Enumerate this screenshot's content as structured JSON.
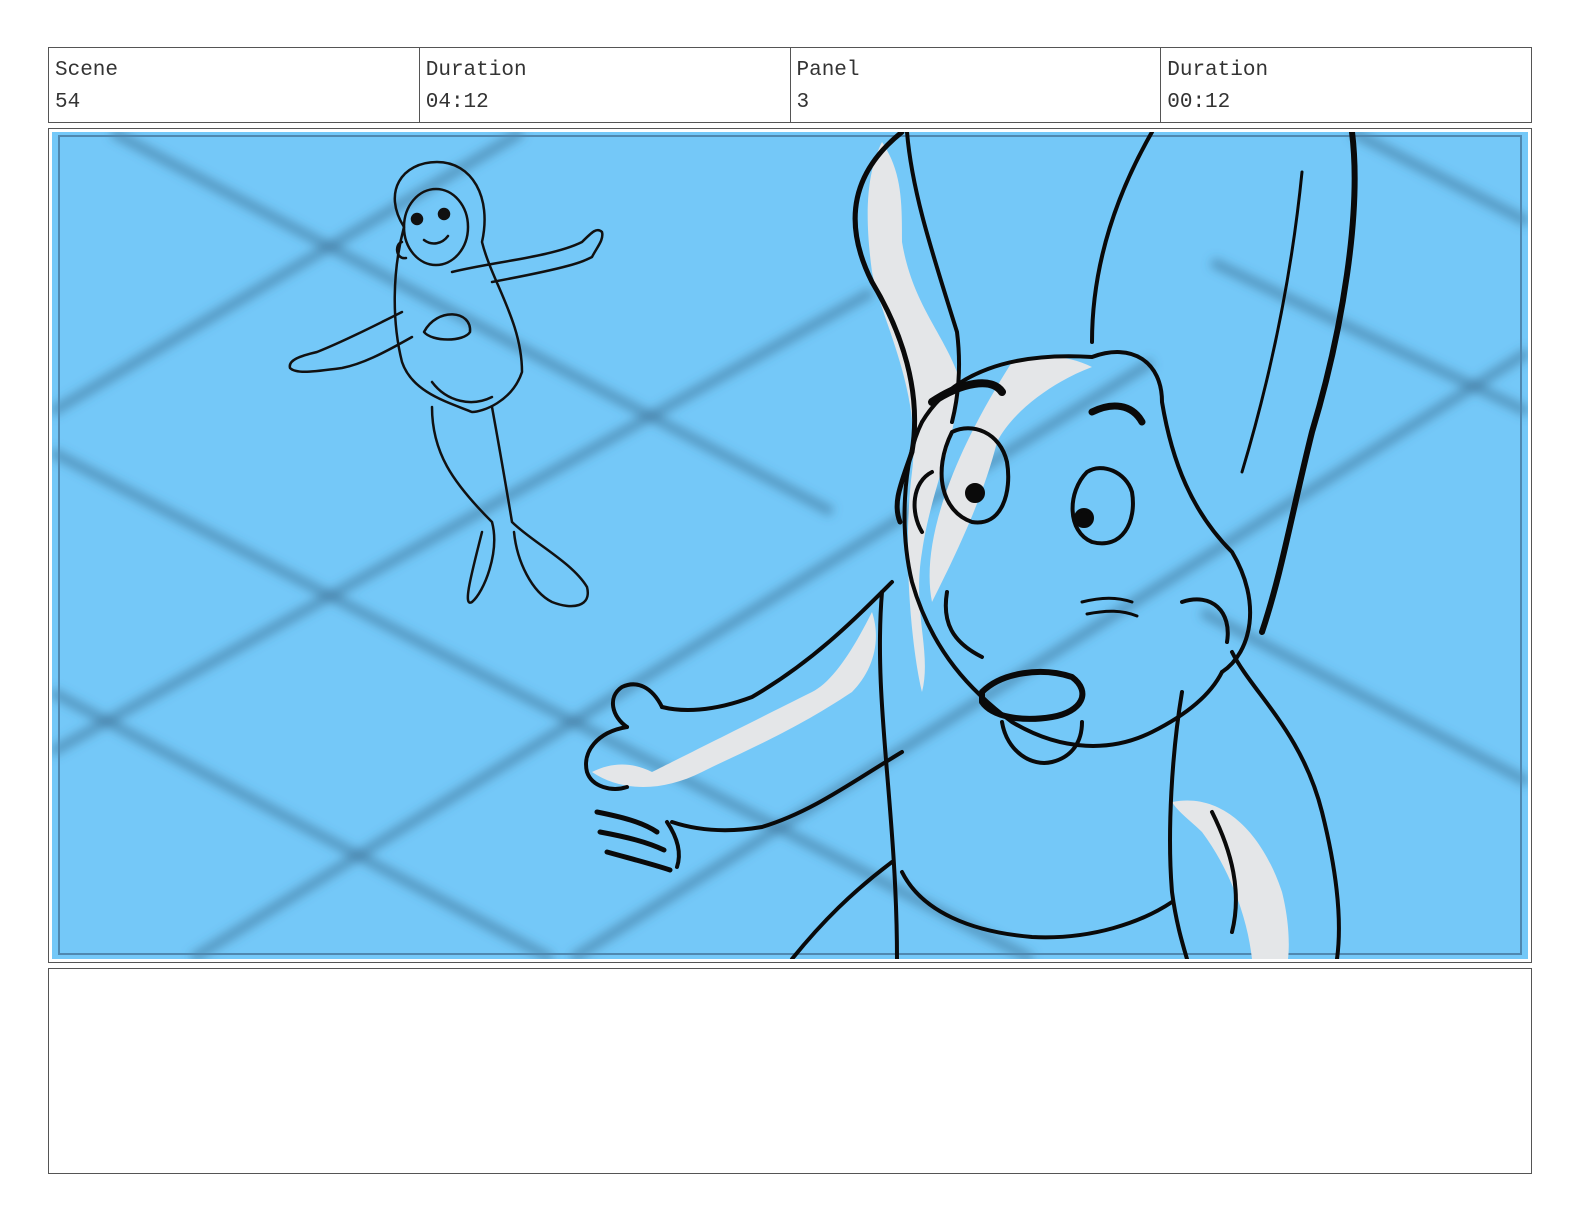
{
  "storyboard": {
    "scene": {
      "label": "Scene",
      "value": "54"
    },
    "scene_duration": {
      "label": "Duration",
      "value": "04:12"
    },
    "panel": {
      "label": "Panel",
      "value": "3"
    },
    "panel_duration": {
      "label": "Duration",
      "value": "00:12"
    },
    "notes": ""
  },
  "art": {
    "background_color": "#74c8f8",
    "line_color": "#0a0a0a",
    "highlight_color": "#e4e6e8",
    "subjects": [
      "mermaid-sketch",
      "creature-closeup-sketch"
    ]
  }
}
